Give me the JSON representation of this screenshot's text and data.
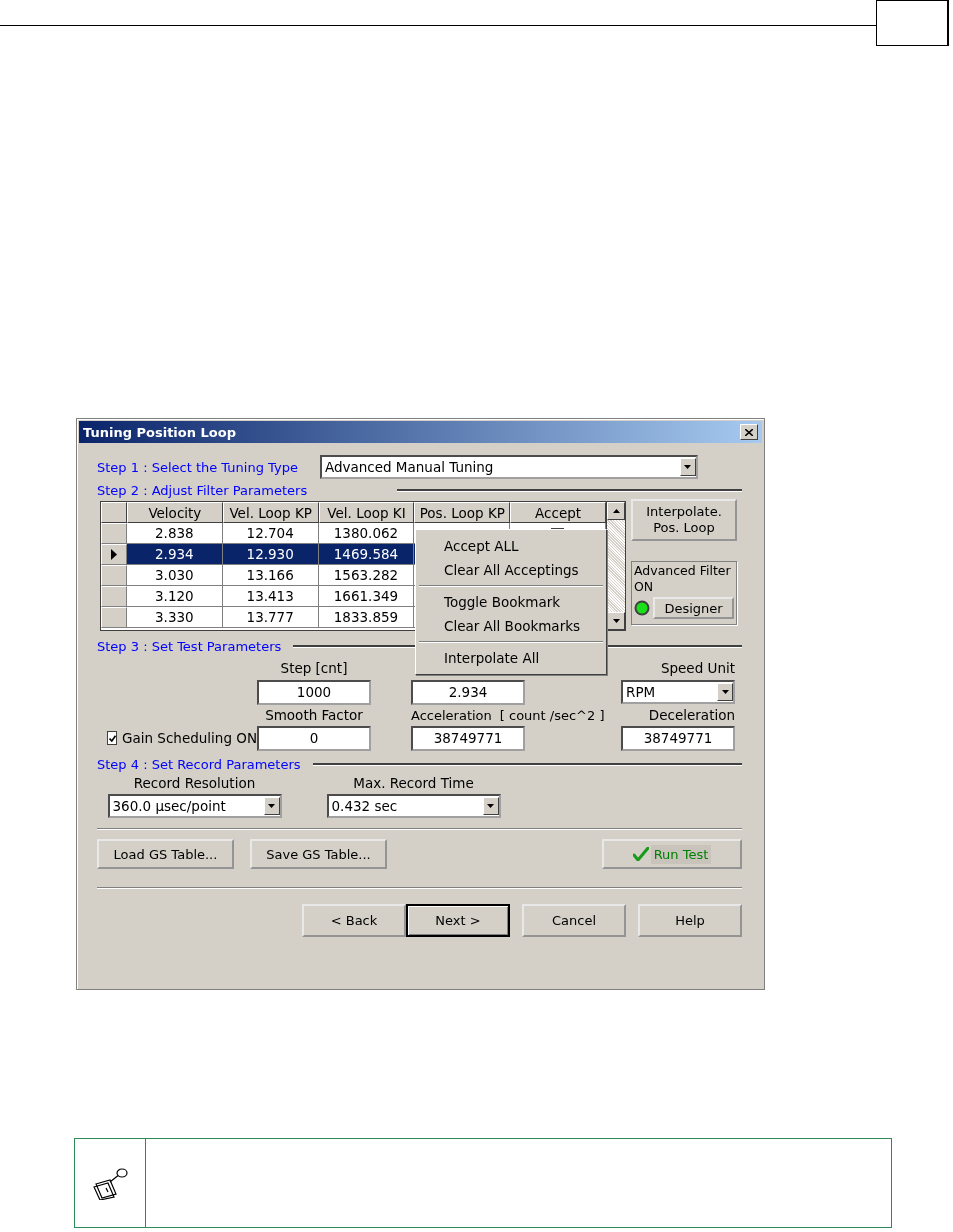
{
  "dialog": {
    "title": "Tuning Position Loop"
  },
  "step1": {
    "label": "Step 1 : Select the  Tuning Type",
    "tuning_type": "Advanced Manual Tuning"
  },
  "step2": {
    "label": "Step 2 :  Adjust Filter Parameters"
  },
  "table": {
    "columns": [
      "Velocity",
      "Vel. Loop KP",
      "Vel. Loop KI",
      "Pos. Loop KP",
      "Accept"
    ],
    "rows": [
      {
        "cells": [
          "2.838",
          "12.704",
          "1380.062"
        ],
        "selected": false
      },
      {
        "cells": [
          "2.934",
          "12.930",
          "1469.584"
        ],
        "selected": true
      },
      {
        "cells": [
          "3.030",
          "13.166",
          "1563.282"
        ],
        "selected": false
      },
      {
        "cells": [
          "3.120",
          "13.413",
          "1661.349"
        ],
        "selected": false
      },
      {
        "cells": [
          "3.330",
          "13.777",
          "1833.859"
        ],
        "selected": false
      }
    ]
  },
  "interpolate_button": "Interpolate. Pos. Loop",
  "advanced_filter": {
    "label": "Advanced Filter ON",
    "led_on": true,
    "designer_button": "Designer"
  },
  "context_menu": {
    "groups": [
      [
        "Accept ALL",
        "Clear All Acceptings"
      ],
      [
        "Toggle Bookmark",
        "Clear All Bookmarks"
      ],
      [
        "Interpolate All"
      ]
    ]
  },
  "step3": {
    "label": "Step 3 : Set Test  Parameters",
    "step_label": "Step [cnt]",
    "step_value": "1000",
    "speed_value": "2.934",
    "speed_unit_label": "Speed Unit",
    "speed_unit": "RPM",
    "gain_scheduling": {
      "label": "Gain Scheduling ON",
      "checked": true
    },
    "smooth_factor_label": "Smooth Factor",
    "smooth_factor": "0",
    "acceleration_label": "Acceleration",
    "units_label": "[ count /sec^2 ]",
    "acceleration": "38749771",
    "deceleration_label": "Deceleration",
    "deceleration": "38749771"
  },
  "step4": {
    "label": "Step 4 : Set Record Parameters",
    "resolution_label": "Record Resolution",
    "resolution": "360.0 µsec/point",
    "time_label": "Max. Record Time",
    "time": "0.432 sec"
  },
  "table_buttons": [
    "Load GS Table...",
    "Save GS Table..."
  ],
  "run_test": "Run Test",
  "nav_buttons": [
    {
      "label": "< Back",
      "default": false
    },
    {
      "label": "Next >",
      "default": true
    },
    {
      "label": "Cancel",
      "default": false
    },
    {
      "label": "Help",
      "default": false
    }
  ]
}
